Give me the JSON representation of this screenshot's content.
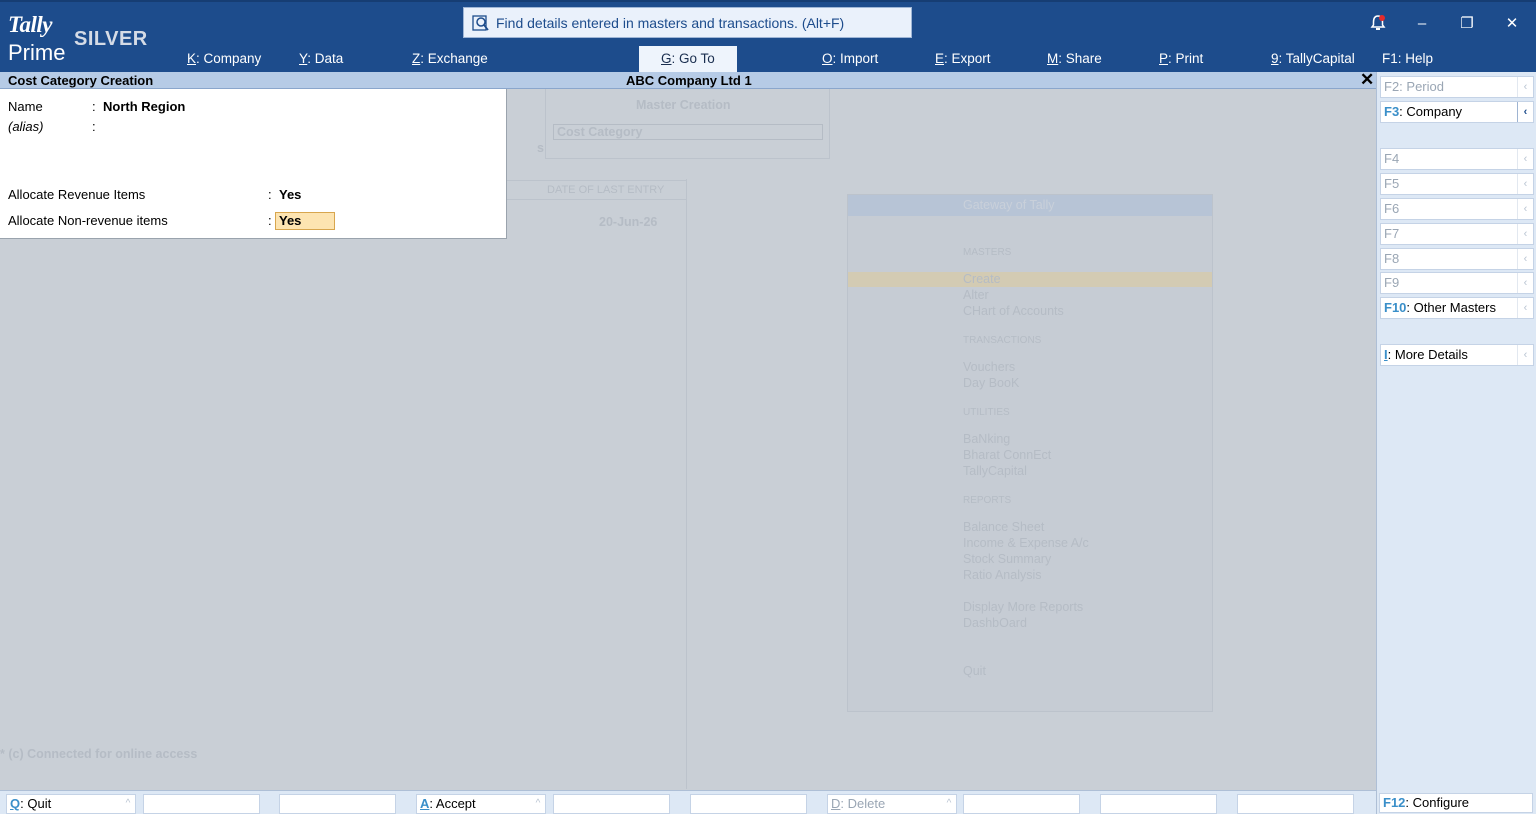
{
  "app": {
    "logo_top": "Tally",
    "logo_bottom": "Prime",
    "edition": "SILVER"
  },
  "search": {
    "placeholder": "Find details entered in masters and transactions. (Alt+F)",
    "icon": "search-icon"
  },
  "window_controls": {
    "notify_icon": "bell-icon",
    "minimize": "–",
    "restore": "❐",
    "close": "✕"
  },
  "menu": [
    {
      "key": "K",
      "label": "Company"
    },
    {
      "key": "Y",
      "label": "Data"
    },
    {
      "key": "Z",
      "label": "Exchange"
    },
    {
      "key": "G",
      "label": "Go To"
    },
    {
      "key": "O",
      "label": "Import"
    },
    {
      "key": "E",
      "label": "Export"
    },
    {
      "key": "M",
      "label": "Share"
    },
    {
      "key": "P",
      "label": "Print"
    },
    {
      "key": "9",
      "label": "TallyCapital"
    },
    {
      "key": "F1",
      "label": "Help"
    }
  ],
  "titlebar": {
    "screen_title": "Cost Category Creation",
    "company": "ABC Company Ltd 1",
    "close": "✕"
  },
  "form": {
    "name_label": "Name",
    "name_value": "North Region",
    "alias_label": "(alias)",
    "alloc_rev_label": "Allocate Revenue Items",
    "alloc_rev_value": "Yes",
    "alloc_nonrev_label": "Allocate Non-revenue items",
    "alloc_nonrev_value": "Yes",
    "sep": ":"
  },
  "background": {
    "master_creation": "Master Creation",
    "cost_category": "Cost Category",
    "s": "s",
    "date_header": "DATE OF LAST ENTRY",
    "date_value": "20-Jun-26",
    "connected": "* (c) Connected for online access",
    "gateway_title": "Gateway of Tally",
    "masters_hdr": "MASTERS",
    "create": "Create",
    "alter": "Alter",
    "chart": "CHart of Accounts",
    "transactions_hdr": "TRANSACTIONS",
    "vouchers": "Vouchers",
    "daybook": "Day BooK",
    "utilities_hdr": "UTILITIES",
    "banking": "BaNking",
    "bharat": "Bharat ConnEct",
    "tallycapital": "TallyCapital",
    "reports_hdr": "REPORTS",
    "balance": "Balance Sheet",
    "income": "Income & Expense A/c",
    "stock": "Stock Summary",
    "ratio": "Ratio Analysis",
    "display_more": "Display More Reports",
    "dashboard": "DashbOard",
    "quit": "Quit"
  },
  "right_panel": [
    {
      "key": "F2",
      "label": "Period",
      "enabled": false
    },
    {
      "key": "F3",
      "label": "Company",
      "enabled": true
    },
    {
      "key": "F4",
      "label": "",
      "enabled": false
    },
    {
      "key": "F5",
      "label": "",
      "enabled": false
    },
    {
      "key": "F6",
      "label": "",
      "enabled": false
    },
    {
      "key": "F7",
      "label": "",
      "enabled": false
    },
    {
      "key": "F8",
      "label": "",
      "enabled": false
    },
    {
      "key": "F9",
      "label": "",
      "enabled": false
    },
    {
      "key": "F10",
      "label": "Other Masters",
      "enabled": true
    },
    {
      "key": "I",
      "label": "More Details",
      "enabled": true
    }
  ],
  "footer": [
    {
      "key": "Q",
      "label": "Quit",
      "enabled": true
    },
    {
      "key": "",
      "label": "",
      "enabled": false
    },
    {
      "key": "",
      "label": "",
      "enabled": false
    },
    {
      "key": "A",
      "label": "Accept",
      "enabled": true
    },
    {
      "key": "",
      "label": "",
      "enabled": false
    },
    {
      "key": "",
      "label": "",
      "enabled": false
    },
    {
      "key": "D",
      "label": "Delete",
      "enabled": false
    },
    {
      "key": "",
      "label": "",
      "enabled": false
    },
    {
      "key": "",
      "label": "",
      "enabled": false
    },
    {
      "key": "",
      "label": "",
      "enabled": false
    }
  ],
  "footer_right": {
    "key": "F12",
    "label": "Configure"
  },
  "chevron": "‹",
  "caret": "^"
}
